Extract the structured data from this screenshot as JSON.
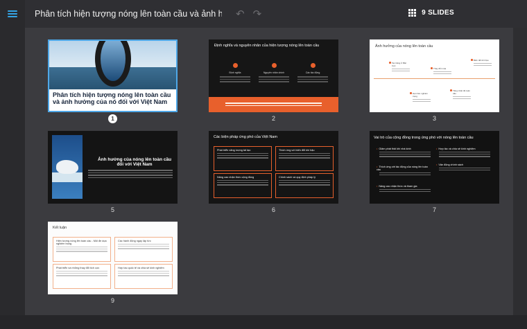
{
  "app": {
    "title": "Phân tích hiện tượng nóng lên toàn cầu và ảnh hưởng của nó ...",
    "slides_count_label": "9 SLIDES",
    "undo_glyph": "↶",
    "redo_glyph": "↷",
    "accent_color": "#e8602c",
    "selected_color": "#4fa8e8"
  },
  "icons": {
    "menu": "hamburger-menu-icon",
    "undo": "undo-icon",
    "redo": "redo-icon",
    "slides": "grid-icon"
  },
  "slides": [
    {
      "number": "1",
      "title": "Phân tích hiện tượng nóng lên toàn cầu và ảnh hưởng của nó đối với Việt Nam"
    },
    {
      "number": "2",
      "title": "Định nghĩa và nguyên nhân của hiện tượng nóng lên toàn cầu"
    },
    {
      "number": "3",
      "title": "Ảnh hưởng của nóng lên toàn cầu"
    },
    {
      "number": "5",
      "title": "Ảnh hưởng của nóng lên toàn cầu đối với Việt Nam"
    },
    {
      "number": "6",
      "title": "Các biện pháp ứng phó của Việt Nam"
    },
    {
      "number": "7",
      "title": "Vai trò của cộng đồng trong ứng phó với nóng lên toàn cầu"
    },
    {
      "number": "9",
      "title": "Kết luận"
    }
  ],
  "slide2": {
    "columns": [
      "Định nghĩa",
      "Nguyên nhân chính",
      "Các tác động"
    ]
  },
  "slide3": {
    "nodes": [
      "Tan băng ở Bắc Cực",
      "Thay đổi mùa",
      "Biến đổi khí hậu",
      "Hạn hán nghiêm trọng",
      "Tăng nhiệt độ toàn cầu"
    ]
  },
  "slide6": {
    "cards": [
      "Phát triển năng lượng tái tạo",
      "Thích ứng với biến đổi khí hậu",
      "Nâng cao nhận thức cộng đồng",
      "Chính sách và quy định pháp lý"
    ]
  },
  "slide7": {
    "items": [
      "Giảm phát thải khí nhà kính",
      "Hợp tác và chia sẻ kinh nghiệm",
      "Vận động chính sách",
      "Thích ứng với tác động của nóng lên toàn cầu",
      "Nâng cao nhận thức và tham gia"
    ]
  },
  "slide9": {
    "cards": [
      "Hiện tượng nóng lên toàn cầu - Mối đe dọa nghiêm trọng",
      "Các hành động ngay lập tức",
      "Phát triển và những thay đổi tích cực",
      "Hợp tác quốc tế và chia sẻ kinh nghiệm"
    ]
  }
}
